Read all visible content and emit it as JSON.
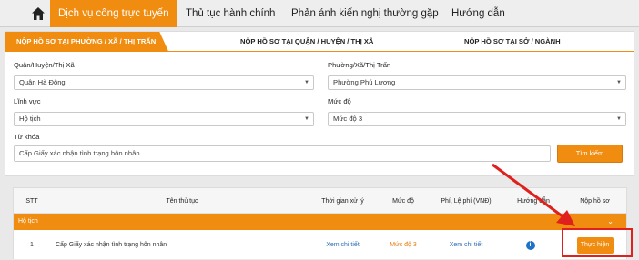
{
  "topnav": {
    "items": [
      {
        "label": "Dịch vụ công trực tuyến"
      },
      {
        "label": "Thủ tục hành chính"
      },
      {
        "label": "Phản ánh kiến nghị thường gặp"
      },
      {
        "label": "Hướng dẫn"
      }
    ]
  },
  "tabs": [
    {
      "label": "NỘP HỒ SƠ TẠI PHƯỜNG / XÃ / THỊ TRẤN"
    },
    {
      "label": "NỘP HỒ SƠ TẠI QUẬN / HUYỆN / THỊ XÃ"
    },
    {
      "label": "NỘP HỒ SƠ TẠI SỞ / NGÀNH"
    }
  ],
  "form": {
    "district_label": "Quận/Huyện/Thị Xã",
    "district_value": "Quận Hà Đông",
    "ward_label": "Phường/Xã/Thị Trấn",
    "ward_value": "Phường Phú Lương",
    "field_label": "Lĩnh vực",
    "field_value": "Hộ tịch",
    "level_label": "Mức độ",
    "level_value": "Mức độ 3",
    "keyword_label": "Từ khóa",
    "keyword_value": "Cấp Giấy xác nhận tình trạng hôn nhân",
    "search_button": "Tìm kiếm"
  },
  "table": {
    "headers": [
      "STT",
      "Tên thủ tục",
      "Thời gian xử lý",
      "Mức độ",
      "Phí, Lệ phí (VNĐ)",
      "Hướng dẫn",
      "Nộp hồ sơ"
    ],
    "group": "Hộ tịch",
    "row": {
      "stt": "1",
      "name": "Cấp Giấy xác nhận tình trạng hôn nhân",
      "time": "Xem chi tiết",
      "level": "Mức độ 3",
      "fee": "Xem chi tiết",
      "guide_icon": "info-icon",
      "action": "Thực hiện"
    }
  },
  "colors": {
    "accent": "#f08c10",
    "highlight": "#e0201c",
    "link": "#2d6fb7"
  }
}
